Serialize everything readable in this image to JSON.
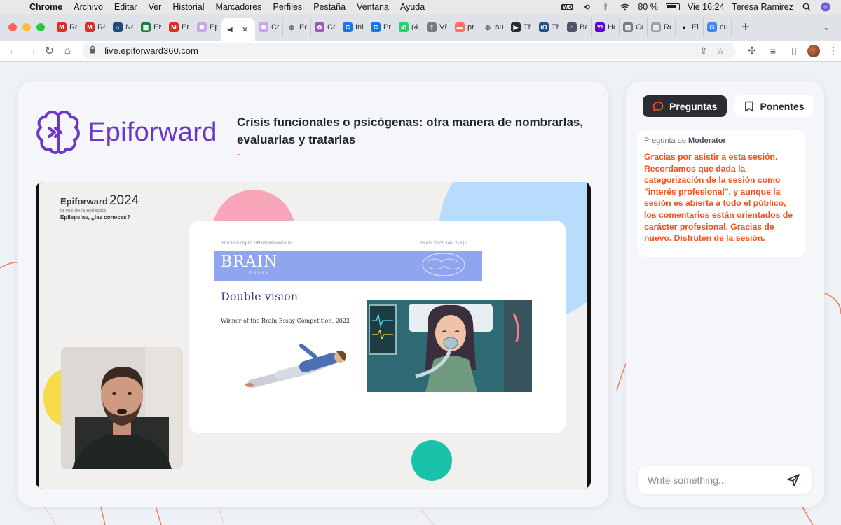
{
  "menubar": {
    "items": [
      "Chrome",
      "Archivo",
      "Editar",
      "Ver",
      "Historial",
      "Marcadores",
      "Perfiles",
      "Pestaña",
      "Ventana",
      "Ayuda"
    ],
    "battery": "80 %",
    "clock": "Vie 16:24",
    "user": "Teresa Ramirez",
    "wd_badge": "WD"
  },
  "tabs": [
    {
      "label": "Re",
      "favicon": "gmail-icon",
      "color": "#d93025"
    },
    {
      "label": "Re",
      "favicon": "gmail-icon",
      "color": "#d93025"
    },
    {
      "label": "Ne",
      "favicon": "nimbus-icon",
      "color": "#1e4b7a"
    },
    {
      "label": "EN",
      "favicon": "sheets-icon",
      "color": "#188038"
    },
    {
      "label": "En",
      "favicon": "gmail-icon",
      "color": "#d93025"
    },
    {
      "label": "Ep",
      "favicon": "epiforward-icon",
      "color": "#c8a6e8"
    },
    {
      "label": "",
      "favicon": "speaker-icon",
      "color": "#444444",
      "active": true,
      "close": "✕"
    },
    {
      "label": "Cr",
      "favicon": "epiforward-icon",
      "color": "#c8a6e8"
    },
    {
      "label": "Ed",
      "favicon": "globe-icon",
      "color": "#5f6368"
    },
    {
      "label": "Ca",
      "favicon": "canva-icon",
      "color": "#9b59b6"
    },
    {
      "label": "Ini",
      "favicon": "c-icon",
      "color": "#1a73e8"
    },
    {
      "label": "Pr",
      "favicon": "c-icon",
      "color": "#1a73e8"
    },
    {
      "label": "(4",
      "favicon": "whatsapp-icon",
      "color": "#25d366"
    },
    {
      "label": "VE",
      "favicon": "tree-icon",
      "color": "#7a7a7a"
    },
    {
      "label": "pr",
      "favicon": "colorful-icon",
      "color": "#ff6f61"
    },
    {
      "label": "su",
      "favicon": "globe-icon",
      "color": "#5f6368"
    },
    {
      "label": "Th",
      "favicon": "arrow-icon",
      "color": "#2b2b2b"
    },
    {
      "label": "Th",
      "favicon": "ios-icon",
      "color": "#1d4f91"
    },
    {
      "label": "Ba",
      "favicon": "inbox-icon",
      "color": "#4a5568"
    },
    {
      "label": "Ho",
      "favicon": "yahoo-icon",
      "color": "#6001d2"
    },
    {
      "label": "Co",
      "favicon": "sheet-icon",
      "color": "#7a7a7a"
    },
    {
      "label": "Re",
      "favicon": "sheet-icon",
      "color": "#9aa0a6"
    },
    {
      "label": "Ele",
      "favicon": "apple-icon",
      "color": "#111111"
    },
    {
      "label": "cu",
      "favicon": "google-icon",
      "color": "#4285f4"
    }
  ],
  "toolbar": {
    "url": "live.epiforward360.com"
  },
  "session": {
    "brand": "Epiforward",
    "title": "Crisis funcionales o psicógenas: otra manera de nombrarlas, evaluarlas y tratarlas",
    "dash": "-"
  },
  "slide": {
    "brand": "Epiforward",
    "year": "2024",
    "subtitle": "la voz de la epilepsia",
    "tagline": "Epilepsias, ¿las conoces?",
    "paper": {
      "doi": "https://doi.org/10.1093/brain/awac409",
      "page_ref": "BRAIN 2023: 146; 2–3   |   2",
      "journal": "BRAIN",
      "section": "ESSAY",
      "title": "Double vision",
      "subtitle": "Winner of the Brain Essay Competition, 2022"
    }
  },
  "panel": {
    "tabs": [
      {
        "label": "Preguntas",
        "icon": "chat-bubble-icon",
        "active": true
      },
      {
        "label": "Ponentes",
        "icon": "bookmark-icon",
        "active": false
      }
    ],
    "message": {
      "prefix": "Pregunta de",
      "author": "Moderator",
      "text": "Gracias por asistir a esta sesión. Recordamos que dada la categorización de la sesión como \"interés profesional\", y aunque la sesión es abierta a todo el público, los comentarios están orientados de carácter profesional. Gracias de nuevo. Disfruten de la sesión."
    },
    "compose_placeholder": "Write something..."
  },
  "colors": {
    "accent": "#ff4d17",
    "brand_purple": "#6b36c9",
    "active_tab_bg": "#2b2d33"
  }
}
